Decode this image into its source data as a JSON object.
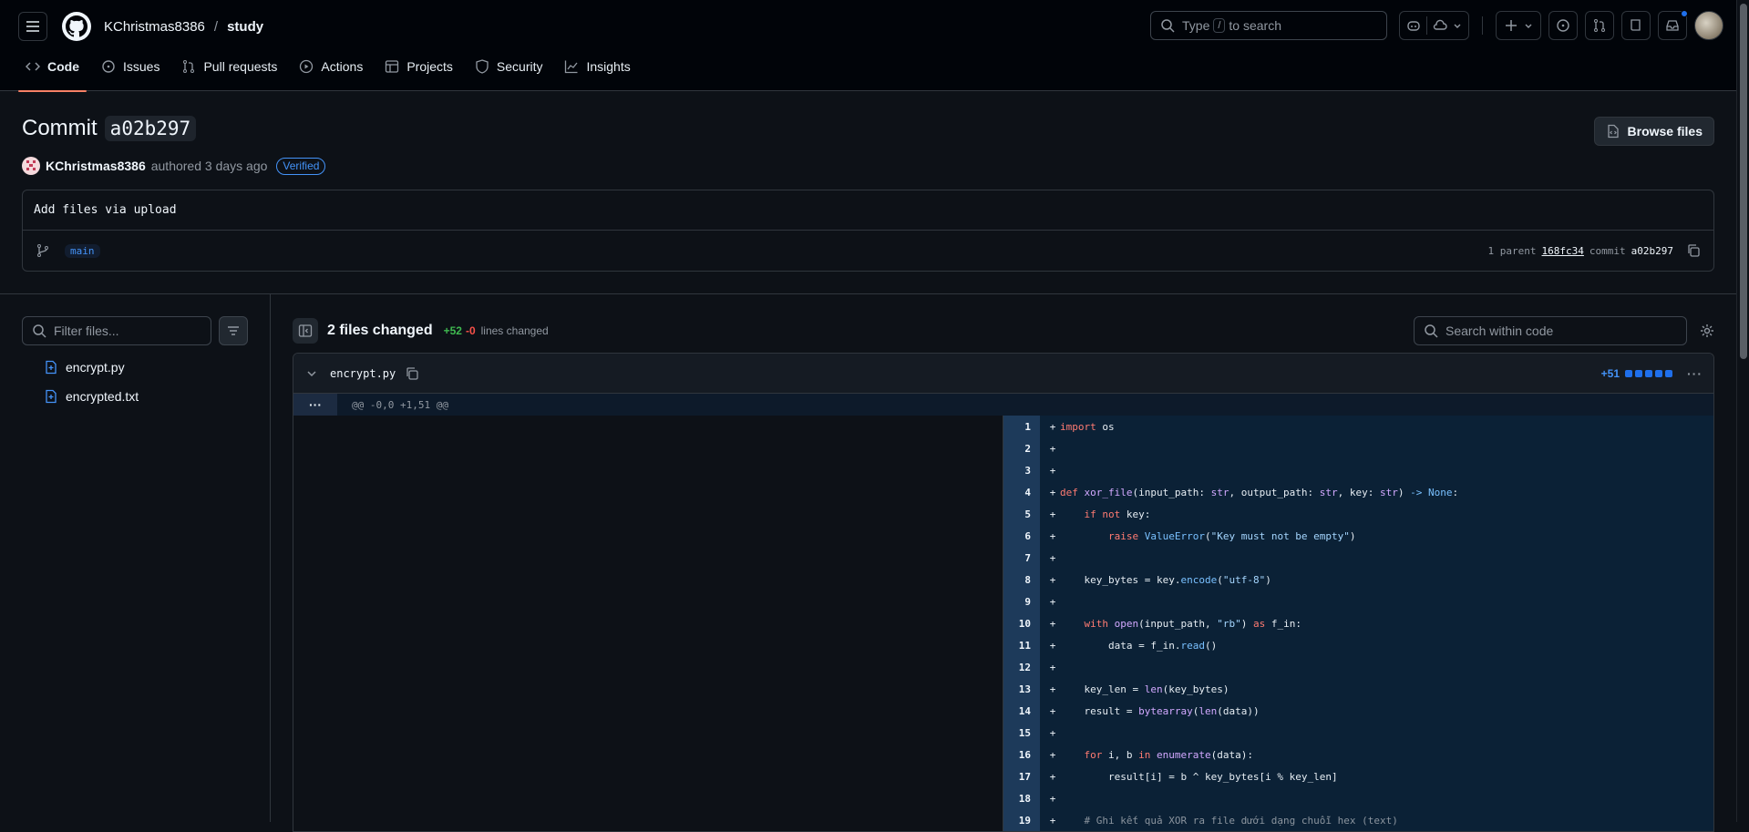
{
  "header": {
    "owner": "KChristmas8386",
    "separator": "/",
    "repo": "study",
    "search_prefix": "Type",
    "search_key": "/",
    "search_suffix": "to search"
  },
  "repo_nav": {
    "tabs": [
      {
        "label": "Code",
        "icon": "code-icon"
      },
      {
        "label": "Issues",
        "icon": "issue-icon"
      },
      {
        "label": "Pull requests",
        "icon": "pull-request-icon"
      },
      {
        "label": "Actions",
        "icon": "play-icon"
      },
      {
        "label": "Projects",
        "icon": "table-icon"
      },
      {
        "label": "Security",
        "icon": "shield-icon"
      },
      {
        "label": "Insights",
        "icon": "graph-icon"
      }
    ]
  },
  "commit": {
    "title_prefix": "Commit",
    "sha": "a02b297",
    "browse_files": "Browse files",
    "author": "KChristmas8386",
    "authored_text": "authored 3 days ago",
    "verified": "Verified",
    "message": "Add files via upload",
    "branch": "main",
    "parent_label": "1 parent",
    "parent_sha": "168fc34",
    "commit_label": "commit",
    "commit_sha": "a02b297"
  },
  "sidebar": {
    "filter_placeholder": "Filter files...",
    "files": [
      "encrypt.py",
      "encrypted.txt"
    ]
  },
  "diff_toolbar": {
    "files_changed": "2 files changed",
    "additions": "+52",
    "deletions": "-0",
    "lines_changed": "lines changed",
    "search_placeholder": "Search within code"
  },
  "diff": {
    "filename": "encrypt.py",
    "stat": "+51",
    "hunk_header": "@@ -0,0 +1,51 @@",
    "expand": "···",
    "lines": [
      {
        "n": "1",
        "code": "import os"
      },
      {
        "n": "2",
        "code": ""
      },
      {
        "n": "3",
        "code": ""
      },
      {
        "n": "4",
        "code": "def xor_file(input_path: str, output_path: str, key: str) -> None:"
      },
      {
        "n": "5",
        "code": "    if not key:"
      },
      {
        "n": "6",
        "code": "        raise ValueError(\"Key must not be empty\")"
      },
      {
        "n": "7",
        "code": ""
      },
      {
        "n": "8",
        "code": "    key_bytes = key.encode(\"utf-8\")"
      },
      {
        "n": "9",
        "code": ""
      },
      {
        "n": "10",
        "code": "    with open(input_path, \"rb\") as f_in:"
      },
      {
        "n": "11",
        "code": "        data = f_in.read()"
      },
      {
        "n": "12",
        "code": ""
      },
      {
        "n": "13",
        "code": "    key_len = len(key_bytes)"
      },
      {
        "n": "14",
        "code": "    result = bytearray(len(data))"
      },
      {
        "n": "15",
        "code": ""
      },
      {
        "n": "16",
        "code": "    for i, b in enumerate(data):"
      },
      {
        "n": "17",
        "code": "        result[i] = b ^ key_bytes[i % key_len]"
      },
      {
        "n": "18",
        "code": ""
      },
      {
        "n": "19",
        "code": "    # Ghi kết quả XOR ra file dưới dạng chuỗi hex (text)"
      }
    ]
  },
  "colors": {
    "background": "#0d1117",
    "header_bg": "#010409",
    "accent_underline": "#f78166",
    "link_blue": "#4493f8",
    "addition_bg": "#0b2136",
    "keyword": "#ff7b72"
  }
}
